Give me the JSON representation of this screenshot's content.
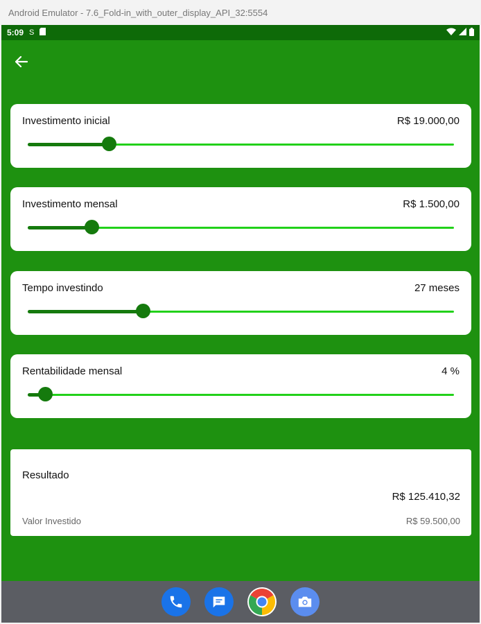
{
  "window": {
    "title": "Android Emulator - 7.6_Fold-in_with_outer_display_API_32:5554"
  },
  "statusbar": {
    "time": "5:09",
    "sim_label": "S"
  },
  "colors": {
    "app_bg": "#1e9110",
    "status_bg": "#0e6a08",
    "slider_active": "#157a0d",
    "slider_inactive": "#22d11a"
  },
  "sliders": [
    {
      "label": "Investimento inicial",
      "value": "R$ 19.000,00",
      "fraction": 0.19
    },
    {
      "label": "Investimento mensal",
      "value": "R$ 1.500,00",
      "fraction": 0.15
    },
    {
      "label": "Tempo investindo",
      "value": "27 meses",
      "fraction": 0.27
    },
    {
      "label": "Rentabilidade mensal",
      "value": "4 %",
      "fraction": 0.04
    }
  ],
  "result": {
    "label": "Resultado",
    "total": "R$ 125.410,32",
    "invested_label": "Valor Investido",
    "invested_value": "R$ 59.500,00"
  },
  "dock": {
    "apps": [
      {
        "icon": "phone-icon"
      },
      {
        "icon": "messages-icon"
      },
      {
        "icon": "chrome-icon"
      },
      {
        "icon": "camera-icon"
      }
    ]
  }
}
